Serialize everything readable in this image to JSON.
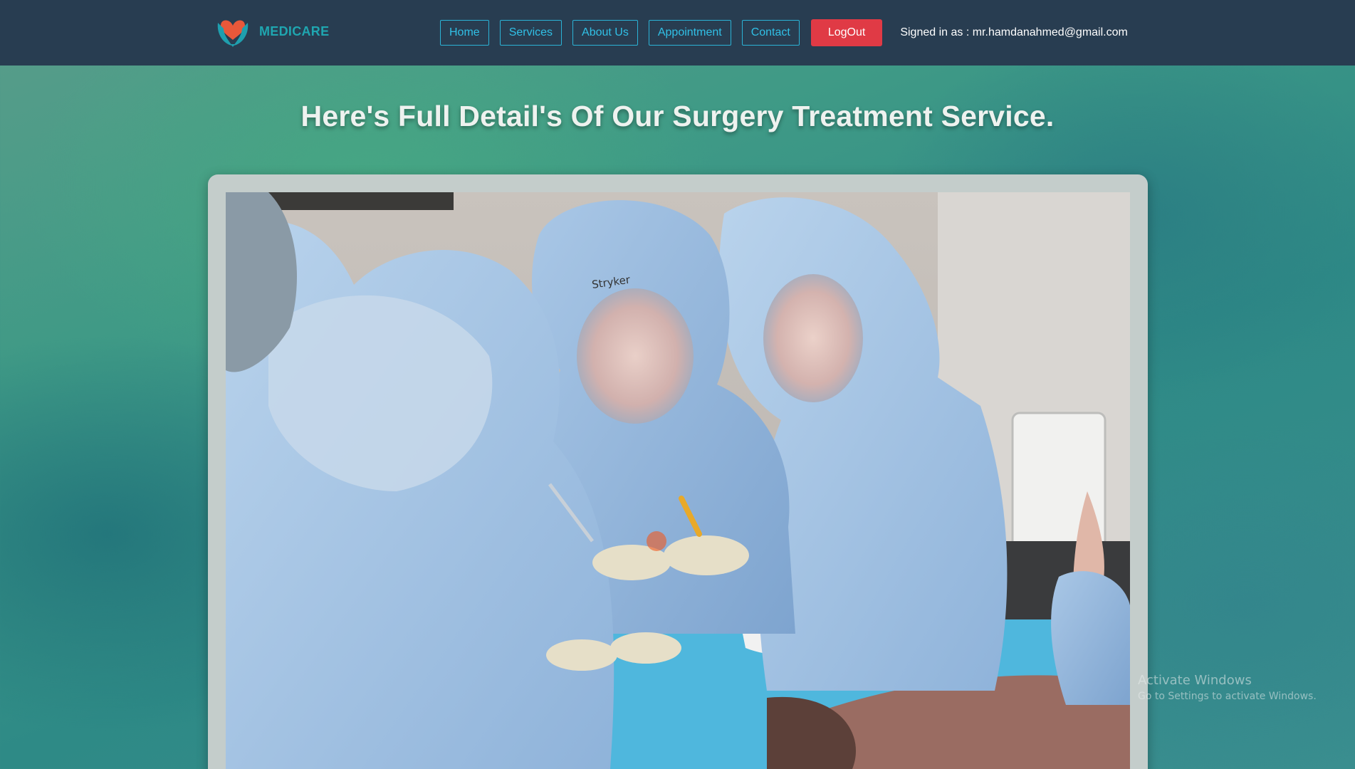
{
  "header": {
    "brand_name": "MEDICARE",
    "logo_icon": "heart-hands-icon",
    "nav": [
      {
        "label": "Home"
      },
      {
        "label": "Services"
      },
      {
        "label": "About Us"
      },
      {
        "label": "Appointment"
      },
      {
        "label": "Contact"
      }
    ],
    "logout_label": "LogOut",
    "signed_in_text": "Signed in as : mr.hamdanahmed@gmail.com"
  },
  "main": {
    "title": "Here's Full Detail's Of Our Surgery Treatment Service.",
    "photo_alt": "surgery-team-photo"
  },
  "watermark": {
    "title": "Activate Windows",
    "subtitle": "Go to Settings to activate Windows."
  },
  "colors": {
    "navbar": "#283d51",
    "nav_accent": "#31c0e6",
    "logout": "#e03a45",
    "brand": "#1fa6b0"
  }
}
